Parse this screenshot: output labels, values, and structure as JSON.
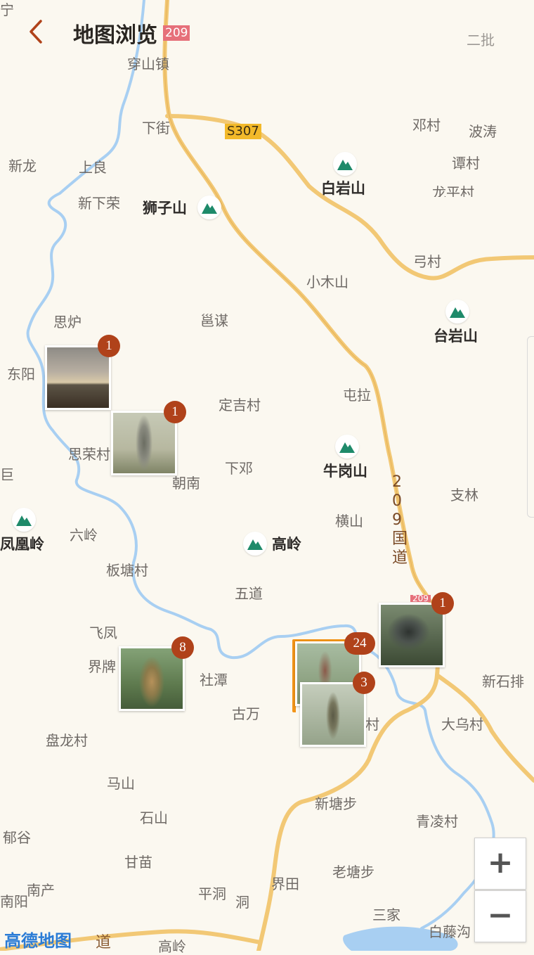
{
  "header": {
    "title": "地图浏览",
    "back_icon": "chevron-left-icon"
  },
  "map": {
    "provider": "高德地图",
    "roads": {
      "s307": "S307",
      "g209_top": "209",
      "g209_vertical": "209国道",
      "g209_bottom": "209",
      "bottom_road": "道"
    },
    "place_labels": [
      "二批",
      "穿山镇",
      "下街",
      "邓村",
      "波涛",
      "新龙",
      "上良",
      "谭村",
      "新下荣",
      "龙平村",
      "弓村",
      "小木山",
      "思炉",
      "邕谋",
      "东阳",
      "屯拉",
      "定吉村",
      "思荣村",
      "下邓",
      "朝南",
      "支林",
      "横山",
      "六岭",
      "板塘村",
      "五道",
      "飞凤",
      "界牌",
      "社潭",
      "新石排",
      "古万",
      "大乌村",
      "盘龙村",
      "马山",
      "新塘步",
      "青凌村",
      "石山",
      "郁谷",
      "甘苗",
      "老塘步",
      "南产",
      "平洞",
      "洞",
      "界田",
      "南阳",
      "三家",
      "白藤沟",
      "高岭",
      "宁",
      "村",
      "巨"
    ],
    "mountains": [
      "白岩山",
      "狮子山",
      "台岩山",
      "牛岗山",
      "高岭",
      "凤凰岭"
    ],
    "photo_markers": [
      {
        "count": "1",
        "subject": "sky-sunset-photo"
      },
      {
        "count": "1",
        "subject": "fish-photo"
      },
      {
        "count": "8",
        "subject": "fish-photo"
      },
      {
        "count": "24",
        "subject": "fish-photo"
      },
      {
        "count": "3",
        "subject": "fish-photo"
      },
      {
        "count": "1",
        "subject": "fish-photo"
      }
    ]
  },
  "zoom": {
    "in_label": "+",
    "out_label": "−"
  },
  "colors": {
    "road_main": "#f0c36b",
    "river": "#9cc8ee",
    "mountain": "#1e8a6a",
    "badge": "#b0421a",
    "accent": "#f29418"
  }
}
